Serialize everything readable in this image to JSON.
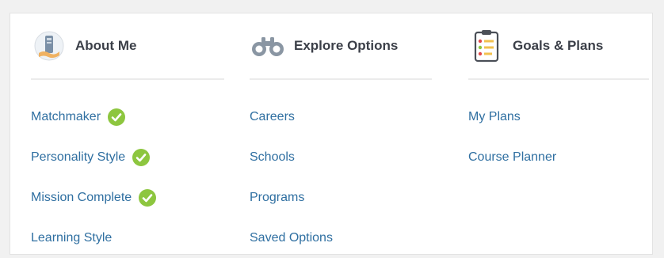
{
  "colors": {
    "link": "#2f6fa1",
    "heading": "#3b3f48",
    "check": "#8dc63f",
    "divider": "#ebebeb"
  },
  "columns": [
    {
      "title": "About Me",
      "icon": "badge-icon",
      "items": [
        {
          "label": "Matchmaker",
          "completed": true
        },
        {
          "label": "Personality Style",
          "completed": true
        },
        {
          "label": "Mission Complete",
          "completed": true
        },
        {
          "label": "Learning Style",
          "completed": false
        }
      ]
    },
    {
      "title": "Explore Options",
      "icon": "binoculars-icon",
      "items": [
        {
          "label": "Careers"
        },
        {
          "label": "Schools"
        },
        {
          "label": "Programs"
        },
        {
          "label": "Saved Options"
        }
      ]
    },
    {
      "title": "Goals & Plans",
      "icon": "checklist-icon",
      "items": [
        {
          "label": "My Plans"
        },
        {
          "label": "Course Planner"
        }
      ]
    }
  ]
}
